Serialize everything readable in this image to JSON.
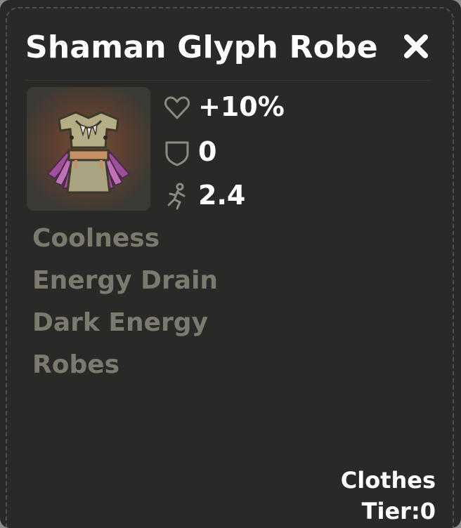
{
  "item": {
    "name": "Shaman Glyph Robe",
    "icon": "shaman-glyph-robe-icon"
  },
  "stats": [
    {
      "icon": "heart-icon",
      "value": "+10%"
    },
    {
      "icon": "shield-icon",
      "value": "0"
    },
    {
      "icon": "running-figure-icon",
      "value": "2.4"
    }
  ],
  "tags": [
    "Coolness",
    "Energy Drain",
    "Dark Energy",
    "Robes"
  ],
  "meta": {
    "category": "Clothes",
    "tier": "Tier:0"
  },
  "colors": {
    "panel_background": "#292a28",
    "title_text": "#ffffff",
    "tag_text": "#7c7a6f",
    "stat_icon": "#8d8a80",
    "slot_background": "#3c3a35"
  }
}
